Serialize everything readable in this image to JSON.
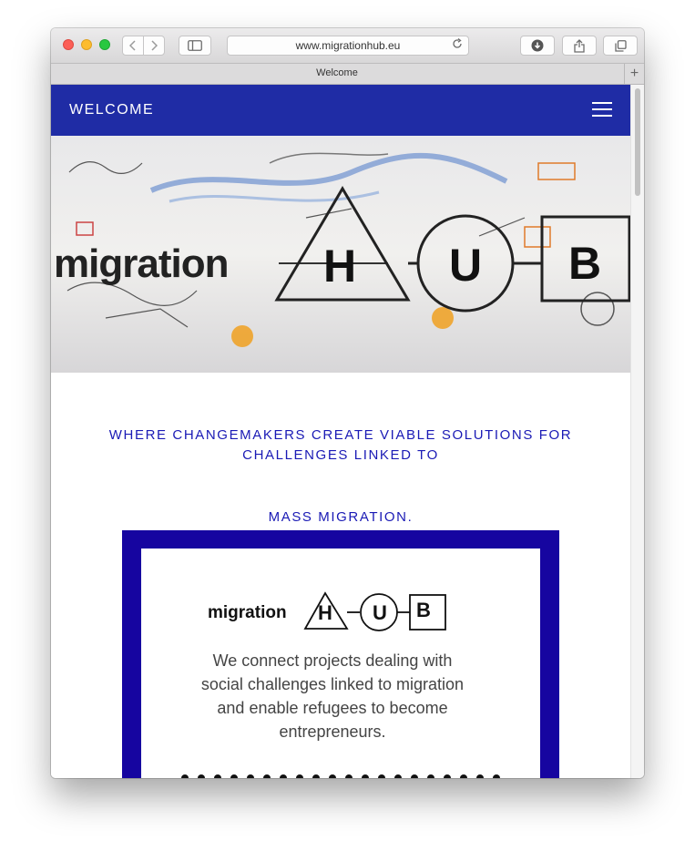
{
  "browser": {
    "url": "www.migrationhub.eu",
    "tab_title": "Welcome",
    "new_tab_label": "+"
  },
  "site": {
    "header_title": "WELCOME",
    "hero": {
      "word": "migration",
      "letters": [
        "H",
        "U",
        "B"
      ]
    },
    "tagline_line1": "WHERE CHANGEMAKERS CREATE VIABLE SOLUTIONS FOR CHALLENGES LINKED TO",
    "tagline_line2": "MASS MIGRATION.",
    "card": {
      "logo_word": "migration",
      "logo_letters": [
        "H",
        "U",
        "B"
      ],
      "description": "We connect projects dealing with social challenges linked to migration and enable refugees to become entrepreneurs."
    }
  },
  "colors": {
    "header_bg": "#1f2ca5",
    "tagline": "#1a1ab5",
    "card_border": "#1605a0"
  },
  "icons": [
    "back-icon",
    "forward-icon",
    "sidebar-icon",
    "reload-icon",
    "download-icon",
    "share-icon",
    "tabs-icon",
    "hamburger-menu-icon"
  ]
}
